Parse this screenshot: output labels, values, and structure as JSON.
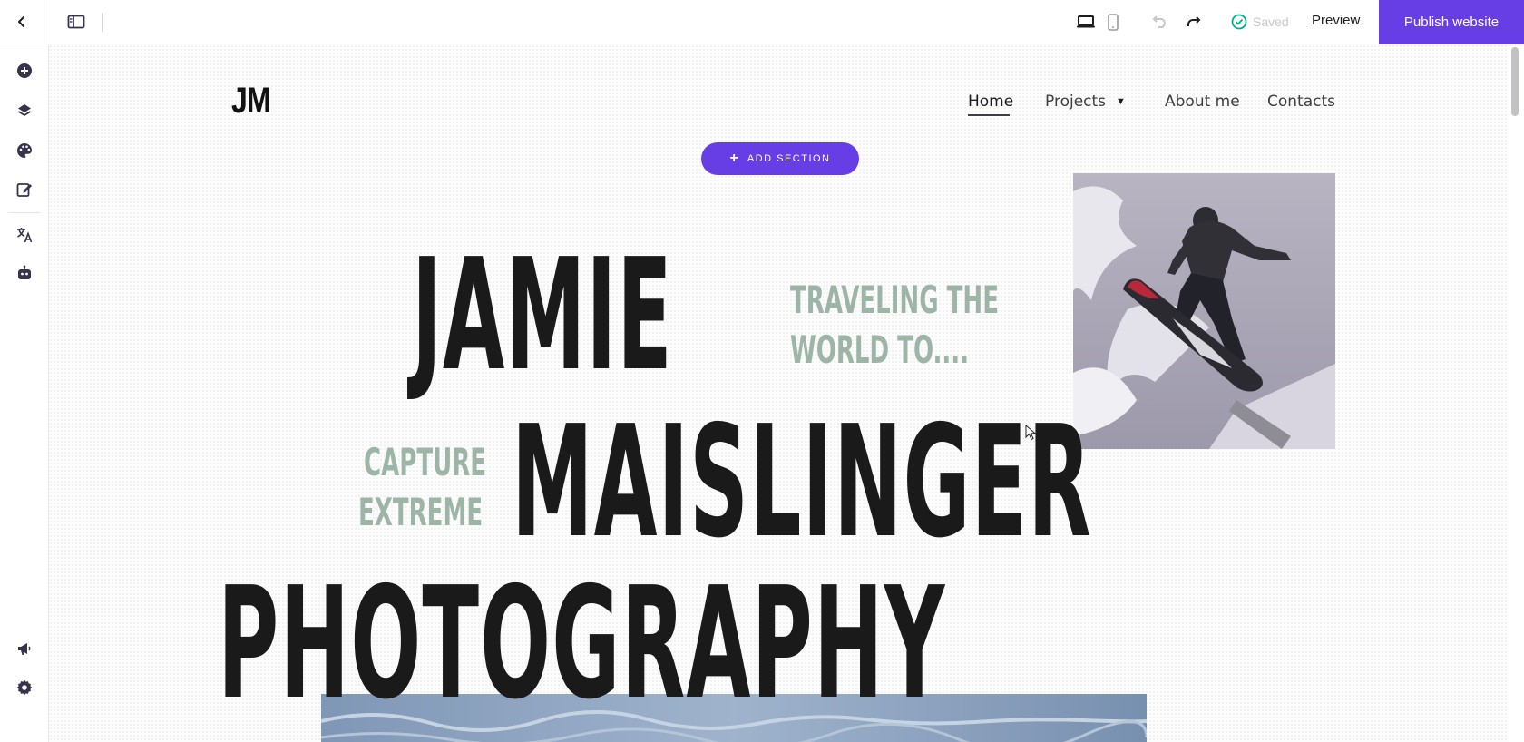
{
  "toolbar": {
    "saved_label": "Saved",
    "preview_label": "Preview",
    "publish_label": "Publish website",
    "accent_color": "#673de6",
    "icons": [
      "chevron-left-icon",
      "sidebar-panel-icon",
      "desktop-icon",
      "mobile-icon",
      "undo-icon",
      "redo-icon",
      "check-circle-icon"
    ]
  },
  "sidebar": {
    "icons": [
      "add-element-icon",
      "layers-icon",
      "palette-icon",
      "edit-page-icon",
      "translate-icon",
      "ai-assistant-icon",
      "announcement-icon",
      "settings-icon"
    ]
  },
  "site": {
    "logo": "JM",
    "nav": {
      "home": "Home",
      "projects": "Projects",
      "projects_caret": "▼",
      "about": "About me",
      "contacts": "Contacts"
    },
    "add_section_label": "ADD SECTION",
    "hero": {
      "line1": "JAMIE",
      "line2": "MAISLINGER",
      "line3": "PHOTOGRAPHY",
      "tagline_right_1": "TRAVELING THE",
      "tagline_right_2": "WORLD TO....",
      "tagline_left_1": "CAPTURE",
      "tagline_left_2": "EXTREME",
      "tagline_color": "#9db5a6"
    }
  }
}
